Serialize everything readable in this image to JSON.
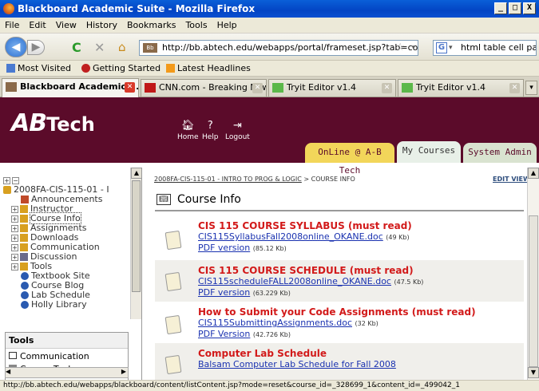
{
  "window": {
    "title": "Blackboard Academic Suite - Mozilla Firefox",
    "controls": [
      "_",
      "□",
      "X"
    ]
  },
  "menu": [
    "File",
    "Edit",
    "View",
    "History",
    "Bookmarks",
    "Tools",
    "Help"
  ],
  "nav": {
    "url": "http://bb.abtech.edu/webapps/portal/frameset.jsp?tab=courses&url=/",
    "search_text": "html table cell paddi"
  },
  "bookmarks": [
    "Most Visited",
    "Getting Started",
    "Latest Headlines"
  ],
  "tabs": [
    {
      "label": "Blackboard Academic ..."
    },
    {
      "label": "CNN.com - Breaking News,..."
    },
    {
      "label": "Tryit Editor v1.4"
    },
    {
      "label": "Tryit Editor v1.4"
    }
  ],
  "banner": {
    "logo_main": "AB",
    "logo_tech": "Tech",
    "links": [
      "Home",
      "Help",
      "Logout"
    ],
    "tabs": [
      "OnLine @ A-B Tech",
      "My Courses",
      "System Admin"
    ]
  },
  "left_tree": {
    "root": "2008FA-CIS-115-01 - I",
    "items": [
      "Announcements",
      "Instructor",
      "Course Info",
      "Assignments",
      "Downloads",
      "Communication",
      "Discussion",
      "Tools",
      "Textbook Site",
      "Course Blog",
      "Lab Schedule",
      "Holly Library"
    ]
  },
  "tools_box": {
    "title": "Tools",
    "items": [
      "Communication",
      "Course Tools"
    ]
  },
  "main": {
    "breadcrumb_link": "2008FA-CIS-115-01 - INTRO TO PROG & LOGIC",
    "breadcrumb_sep": " > ",
    "breadcrumb_current": "COURSE INFO",
    "edit_view": "EDIT VIEW",
    "title": "Course Info",
    "items": [
      {
        "title": "CIS 115 COURSE SYLLABUS (must read)",
        "link1": "CIS115SyllabusFall2008online_OKANE.doc",
        "size1": "(49 Kb)",
        "link2": "PDF version",
        "size2": "(85.12 Kb)"
      },
      {
        "title": "CIS 115 COURSE SCHEDULE (must read)",
        "link1": "CIS115scheduleFALL2008online_OKANE.doc",
        "size1": "(47.5 Kb)",
        "link2": "PDF version",
        "size2": "(63.229 Kb)"
      },
      {
        "title": "How to Submit your Code Assignments (must read)",
        "link1": "CIS115SubmittingAssignments.doc",
        "size1": "(32 Kb)",
        "link2": "PDF Version",
        "size2": "(42.726 Kb)"
      },
      {
        "title": "Computer Lab Schedule",
        "link1": "Balsam Computer Lab Schedule for Fall 2008",
        "size1": "",
        "link2": "",
        "size2": ""
      }
    ]
  },
  "status": "http://bb.abtech.edu/webapps/blackboard/content/listContent.jsp?mode=reset&course_id=_328699_1&content_id=_499042_1",
  "colors": {
    "banner": "#5b0b2a",
    "title_red": "#d21a1a",
    "link_blue": "#1a32b0",
    "online_tab": "#f2d65a",
    "mycourses_tab": "#e8f0e8",
    "sysadmin_tab": "#d9e3d0"
  }
}
